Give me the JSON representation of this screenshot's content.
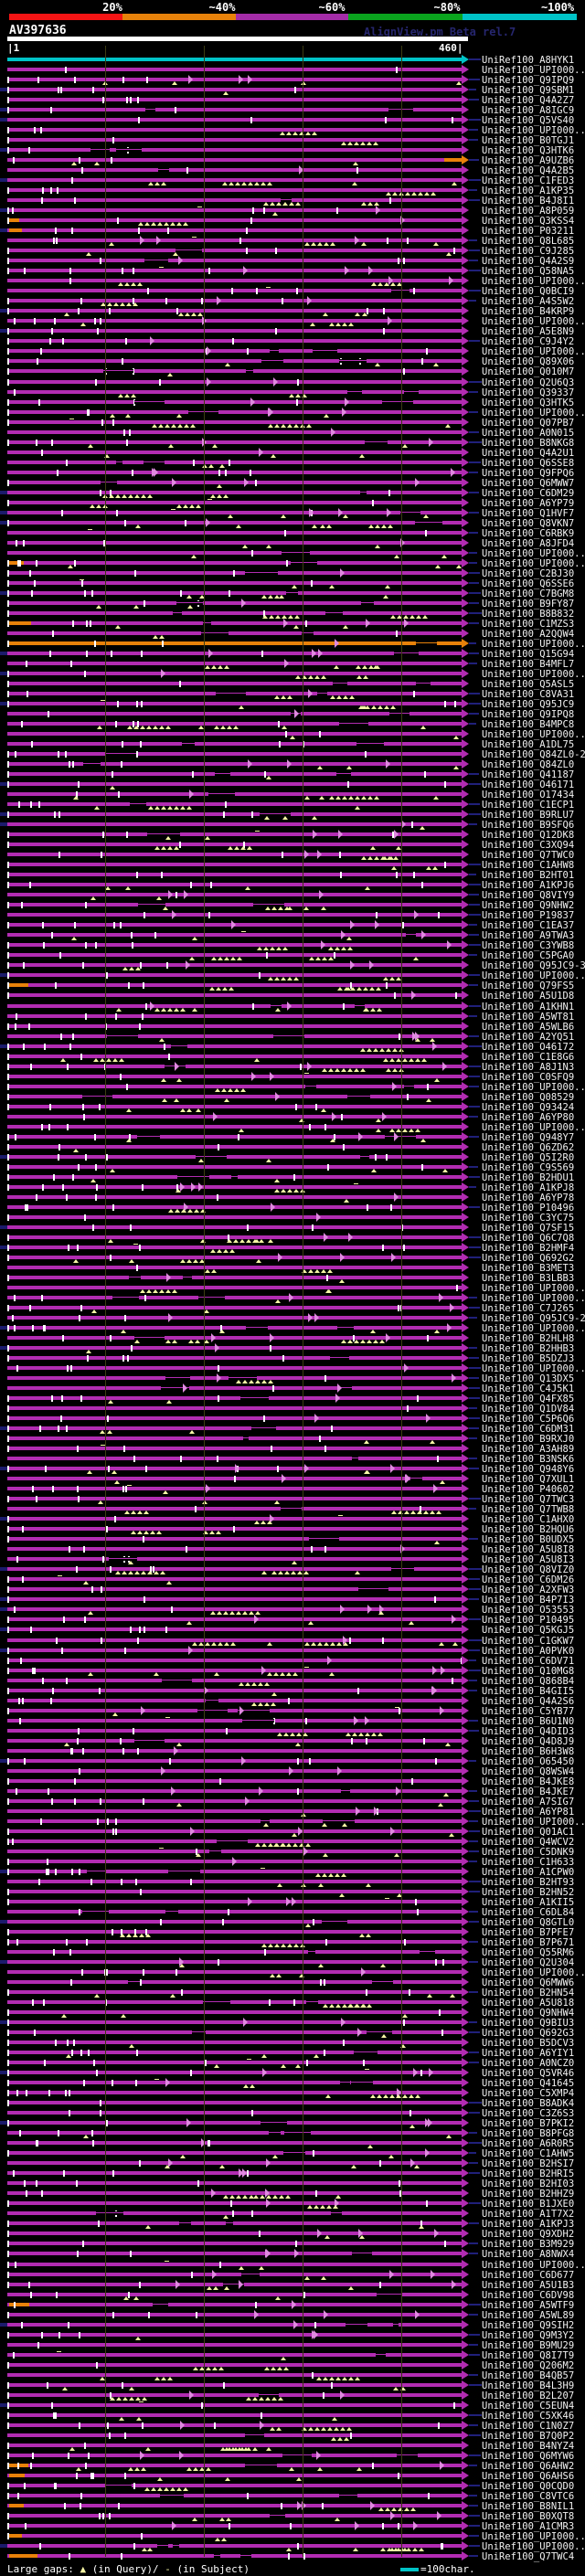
{
  "scale": {
    "labels": [
      "20%",
      "~40%",
      "~60%",
      "~80%",
      "~100%"
    ],
    "label_centers": [
      123,
      243,
      363,
      489,
      610
    ],
    "colors": [
      "#f51414",
      "#e8820a",
      "#a42ca8",
      "#0aa41e",
      "#00c3c7"
    ],
    "segments": [
      [
        10,
        124
      ],
      [
        134,
        124
      ],
      [
        258,
        123
      ],
      [
        381,
        125
      ],
      [
        506,
        125
      ]
    ]
  },
  "header": {
    "query_title": "AV397636",
    "watermark": "AlignView.pm Beta rel.7"
  },
  "ruler": {
    "start": "|1",
    "end": "460|"
  },
  "colors": {
    "bar_magenta": "#b22cb2",
    "bar_cyan": "#00c3c7",
    "bar_orange": "#e8820a",
    "navy": "#1b1b6b",
    "yellow": "#f7f7a5",
    "gridline": "#3c3c12"
  },
  "legend": {
    "gaps_prefix": "Large gaps:",
    "query_gap_glyph": "▲",
    "query_gap_text": "(in Query)/",
    "subject_gap_glyph": "-",
    "subject_gap_text": " (in Subject)",
    "scale_text": "=100char."
  },
  "special_rows": {
    "cyan_rows": [
      1
    ],
    "orange_rows": [
      59
    ],
    "orange_lead_rows": [
      17,
      18,
      51,
      57,
      93,
      224,
      240,
      241,
      244,
      247,
      249
    ],
    "orange_tail_rows": [
      11
    ]
  },
  "hit_ids": [
    "UniRef100_A8HYK1",
    "UniRef100_UPI000..",
    "UniRef100_Q9IPQ9",
    "UniRef100_Q9SBM1",
    "UniRef100_Q4A2Z7",
    "UniRef100_A8IGC9",
    "UniRef100_Q5VS40",
    "UniRef100_UPI000..",
    "UniRef100_B0TGJ1",
    "UniRef100_Q3HTK6",
    "UniRef100_A9UZB6",
    "UniRef100_Q4A2B5",
    "UniRef100_C1FED3",
    "UniRef100_A1KP35",
    "UniRef100_B4J8I1",
    "UniRef100_A8P059",
    "UniRef100_Q3KSS4",
    "UniRef100_P03211",
    "UniRef100_Q8L685",
    "UniRef100_C9J285",
    "UniRef100_Q4A2S9",
    "UniRef100_Q58NA5",
    "UniRef100_UPI000..",
    "UniRef100_Q0BCI9",
    "UniRef100_A4S5W2",
    "UniRef100_B4KRP9",
    "UniRef100_UPI000..",
    "UniRef100_A5E8N9",
    "UniRef100_C9J4Y2",
    "UniRef100_UPI000..",
    "UniRef100_Q89X06",
    "UniRef100_Q010M7",
    "UniRef100_Q2U6Q3",
    "UniRef100_Q39337",
    "UniRef100_Q3HTK5",
    "UniRef100_UPI000..",
    "UniRef100_Q07PB7",
    "UniRef100_A0N015",
    "UniRef100_B8NKG8",
    "UniRef100_Q4A2U1",
    "UniRef100_Q6SSE8",
    "UniRef100_Q9FPQ6",
    "UniRef100_Q6MWW7",
    "UniRef100_C6DM29",
    "UniRef100_A6YP79",
    "UniRef100_Q1HVF7",
    "UniRef100_Q8VKN7",
    "UniRef100_C6RBK9",
    "UniRef100_A8JFD4",
    "UniRef100_UPI000..",
    "UniRef100_UPI000..",
    "UniRef100_C2BJ30",
    "UniRef100_Q6SSE6",
    "UniRef100_C7BGM8",
    "UniRef100_B9FY87",
    "UniRef100_B8B832",
    "UniRef100_C1MZS3",
    "UniRef100_A2QQW4",
    "UniRef100_UPI000..",
    "UniRef100_Q15G94",
    "UniRef100_B4MFL7",
    "UniRef100_UPI000..",
    "UniRef100_Q5ASL5",
    "UniRef100_C8VA31",
    "UniRef100_Q95JC9",
    "UniRef100_Q9IPQ8",
    "UniRef100_B4MPC8",
    "UniRef100_UPI000..",
    "UniRef100_A1DL75",
    "UniRef100_Q84ZL0-2",
    "UniRef100_Q84ZL0",
    "UniRef100_Q41187",
    "UniRef100_O46171",
    "UniRef100_O17434",
    "UniRef100_C1ECP1",
    "UniRef100_B9RLU7",
    "UniRef100_B9SFQ6",
    "UniRef100_Q12DK8",
    "UniRef100_C3XQ94",
    "UniRef100_Q7TWC0",
    "UniRef100_C1AHW8",
    "UniRef100_B2HT01",
    "UniRef100_A1KPJ6",
    "UniRef100_Q8VIY9",
    "UniRef100_Q9NHW2",
    "UniRef100_P19837",
    "UniRef100_C1EA37",
    "UniRef100_A9TWA3",
    "UniRef100_C3YWB8",
    "UniRef100_C5PGA0",
    "UniRef100_Q95JC9-3",
    "UniRef100_UPI000..",
    "UniRef100_Q79FS5",
    "UniRef100_A5U1D8",
    "UniRef100_A1KHN1",
    "UniRef100_A5WT81",
    "UniRef100_A5WLB6",
    "UniRef100_A2YQ51",
    "UniRef100_O46172",
    "UniRef100_C1E8G6",
    "UniRef100_A8J1N3",
    "UniRef100_C0SFQ9",
    "UniRef100_UPI000..",
    "UniRef100_Q08529",
    "UniRef100_Q93424",
    "UniRef100_A6YP80",
    "UniRef100_UPI000..",
    "UniRef100_Q948Y7",
    "UniRef100_Q6ZD62",
    "UniRef100_Q5I2R0",
    "UniRef100_C9S569",
    "UniRef100_B2HDU1",
    "UniRef100_A1KPJ8",
    "UniRef100_A6YP78",
    "UniRef100_P10496",
    "UniRef100_C3YC75",
    "UniRef100_Q7SF15",
    "UniRef100_Q6C7Q8",
    "UniRef100_B2HMF4",
    "UniRef100_Q692G2",
    "UniRef100_B3MET3",
    "UniRef100_B3LBB3",
    "UniRef100_UPI000..",
    "UniRef100_UPI000..",
    "UniRef100_C7J265",
    "UniRef100_Q95JC9-2",
    "UniRef100_UPI000..",
    "UniRef100_B2HLH8",
    "UniRef100_B2HHB3",
    "UniRef100_B5DZJ3",
    "UniRef100_UPI000..",
    "UniRef100_Q13DX5",
    "UniRef100_C4J5K1",
    "UniRef100_Q4FX85",
    "UniRef100_Q1DV84",
    "UniRef100_C5P6Q6",
    "UniRef100_C6DM31",
    "UniRef100_B9RXJ0",
    "UniRef100_A3AH89",
    "UniRef100_B3NSK6",
    "UniRef100_Q948Y6",
    "UniRef100_Q7XUL1",
    "UniRef100_P40602",
    "UniRef100_Q7TWC3",
    "UniRef100_Q7TWB8",
    "UniRef100_C1AHX0",
    "UniRef100_B2HQU6",
    "UniRef100_B0UDX5",
    "UniRef100_A5U8I8",
    "UniRef100_A5U8I3",
    "UniRef100_Q8VIZ0",
    "UniRef100_C6DM26",
    "UniRef100_A2XFW3",
    "UniRef100_B4P7I3",
    "UniRef100_O53553",
    "UniRef100_P10495",
    "UniRef100_Q5KGJ5",
    "UniRef100_C1GKW7",
    "UniRef100_A0PVK0",
    "UniRef100_C6DV71",
    "UniRef100_Q10MG8",
    "UniRef100_Q868B4",
    "UniRef100_B4GII5",
    "UniRef100_Q4A2S6",
    "UniRef100_C5YB77",
    "UniRef100_B6U1N0",
    "UniRef100_Q4DID3",
    "UniRef100_Q4D8J9",
    "UniRef100_B6H3W8",
    "UniRef100_O65450",
    "UniRef100_Q8WSW4",
    "UniRef100_B4JKE8",
    "UniRef100_B4JKE7",
    "UniRef100_A7SIG7",
    "UniRef100_A6YP81",
    "UniRef100_UPI000..",
    "UniRef100_Q01AC1",
    "UniRef100_Q4WCV2",
    "UniRef100_C5DNK9",
    "UniRef100_C1H633",
    "UniRef100_A1CPW0",
    "UniRef100_B2HT93",
    "UniRef100_B2HN52",
    "UniRef100_A1KII5",
    "UniRef100_C6DL84",
    "UniRef100_Q8GTL0",
    "UniRef100_B7PFE7",
    "UniRef100_B7P671",
    "UniRef100_Q55RM6",
    "UniRef100_Q2U304",
    "UniRef100_UPI000..",
    "UniRef100_Q6MWW6",
    "UniRef100_B2HN54",
    "UniRef100_A5U818",
    "UniRef100_Q9NHW4",
    "UniRef100_Q9BIU3",
    "UniRef100_Q692G3",
    "UniRef100_B5DCV3",
    "UniRef100_A6YIY1",
    "UniRef100_A0NCZ0",
    "UniRef100_Q5VR46",
    "UniRef100_Q41645",
    "UniRef100_C5XMP4",
    "UniRef100_B8ADK4",
    "UniRef100_C3Z6S3",
    "UniRef100_B7PKI2",
    "UniRef100_B8PFG8",
    "UniRef100_A6R0R5",
    "UniRef100_C1AHW5",
    "UniRef100_B2HSI7",
    "UniRef100_B2HRI5",
    "UniRef100_B2HI03",
    "UniRef100_B2HHZ9",
    "UniRef100_B1JXE0",
    "UniRef100_A1T7X2",
    "UniRef100_A1KPJ3",
    "UniRef100_Q9XDH2",
    "UniRef100_B3M929",
    "UniRef100_A8NWX4",
    "UniRef100_UPI000..",
    "UniRef100_C6D677",
    "UniRef100_A5U1B3",
    "UniRef100_C6DV98",
    "UniRef100_A5WTF9",
    "UniRef100_A5WL89",
    "UniRef100_Q9SIH2",
    "UniRef100_Q9M3Y2",
    "UniRef100_B9MU29",
    "UniRef100_Q8I7T9",
    "UniRef100_Q206M2",
    "UniRef100_B4QB57",
    "UniRef100_B4L3H9",
    "UniRef100_B2L207",
    "UniRef100_C5EUN4",
    "UniRef100_C5XK46",
    "UniRef100_C1N0Z7",
    "UniRef100_B7Q0P2",
    "UniRef100_B4NYZ4",
    "UniRef100_Q6MYW6",
    "UniRef100_Q6AHW2",
    "UniRef100_Q6AHS6",
    "UniRef100_Q0CQD0",
    "UniRef100_C8VTC6",
    "UniRef100_B8NIL1",
    "UniRef100_B0XQT8",
    "UniRef100_A1CMR3",
    "UniRef100_UPI000..",
    "UniRef100_UPI000..",
    "UniRef100_Q7TWC4"
  ]
}
